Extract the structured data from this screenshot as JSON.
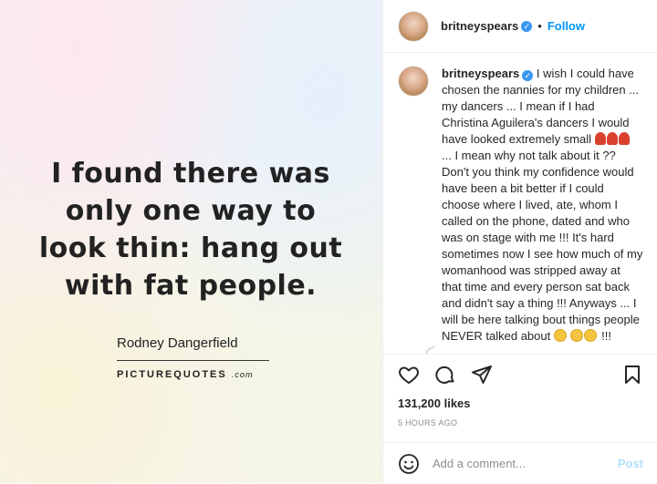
{
  "image": {
    "quote": "I found there was only one way to look thin: hang out with fat people.",
    "author": "Rodney Dangerfield",
    "brand_main": "PICTUREQUOTES",
    "brand_suffix": ".com"
  },
  "header": {
    "username": "britneyspears",
    "separator": "•",
    "follow_label": "Follow"
  },
  "caption": {
    "username": "britneyspears",
    "text_part1": "I wish I could have chosen the nannies for my children ... my dancers ... I mean if I had Christina Aguilera's dancers I would have looked extremely small ",
    "text_part2": "... I mean why not talk about it ?? Don't you think my confidence would have been a bit better if I could choose where I lived, ate, whom I called on the phone, dated and who was on stage with me !!! It's hard sometimes now I see how much of my womanhood was stripped away at that time and every person sat back and didn't say a thing !!! Anyways ... I will be here talking bout things people NEVER talked about ",
    "text_end": "!!!",
    "age": "5h"
  },
  "stats": {
    "likes": "131,200 likes",
    "posted": "5 HOURS AGO"
  },
  "comment_box": {
    "placeholder": "Add a comment...",
    "post_label": "Post"
  },
  "icons": {
    "like": "heart-icon",
    "comment": "comment-icon",
    "share": "share-icon",
    "save": "bookmark-icon",
    "emoji": "smiley-icon"
  },
  "colors": {
    "accent": "#0095f6",
    "verified": "#3897f0",
    "post_disabled": "#b2dffc"
  }
}
